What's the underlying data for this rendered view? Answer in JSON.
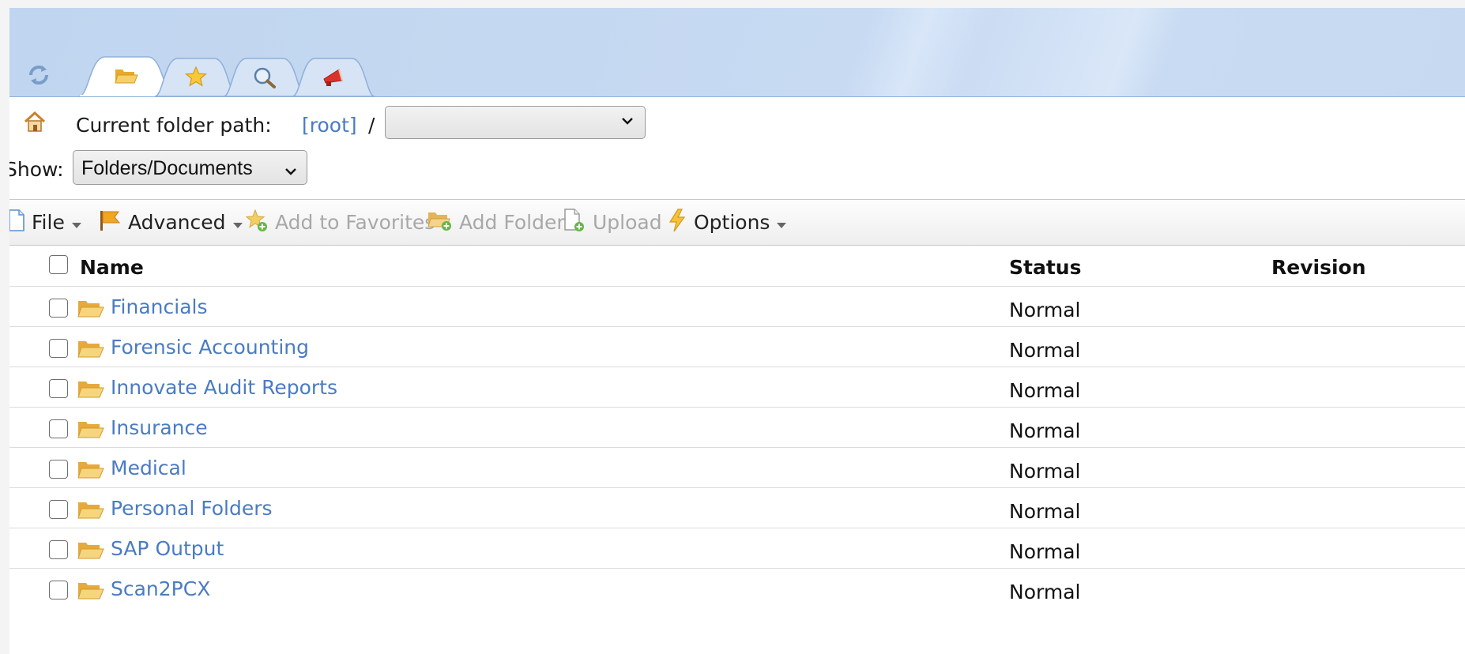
{
  "tabs": [
    {
      "name": "folders",
      "icon": "open-folder-icon",
      "active": true
    },
    {
      "name": "favorites",
      "icon": "star-icon",
      "active": false
    },
    {
      "name": "search",
      "icon": "magnifier-icon",
      "active": false
    },
    {
      "name": "announcements",
      "icon": "megaphone-icon",
      "active": false
    }
  ],
  "path": {
    "label": "Current folder path:",
    "root": "[root]",
    "separator": "/",
    "folder_select_value": ""
  },
  "show": {
    "label": "Show:",
    "selected": "Folders/Documents"
  },
  "toolbar": {
    "file": "File",
    "advanced": "Advanced",
    "add_favorites": "Add to Favorites",
    "add_folder": "Add Folder",
    "upload": "Upload",
    "options": "Options"
  },
  "table": {
    "columns": [
      "Name",
      "Status",
      "Revision"
    ],
    "rows": [
      {
        "name": "Financials",
        "status": "Normal",
        "revision": ""
      },
      {
        "name": "Forensic Accounting",
        "status": "Normal",
        "revision": ""
      },
      {
        "name": "Innovate Audit Reports",
        "status": "Normal",
        "revision": ""
      },
      {
        "name": "Insurance",
        "status": "Normal",
        "revision": ""
      },
      {
        "name": "Medical",
        "status": "Normal",
        "revision": ""
      },
      {
        "name": "Personal Folders",
        "status": "Normal",
        "revision": ""
      },
      {
        "name": "SAP Output",
        "status": "Normal",
        "revision": ""
      },
      {
        "name": "Scan2PCX",
        "status": "Normal",
        "revision": ""
      }
    ]
  },
  "colors": {
    "link": "#4a7bc4",
    "header_bg": "#c6d9f1",
    "tab_border": "#8fb0db",
    "disabled_text": "#a8a8a8",
    "folder_yellow": "#f2c14e"
  }
}
